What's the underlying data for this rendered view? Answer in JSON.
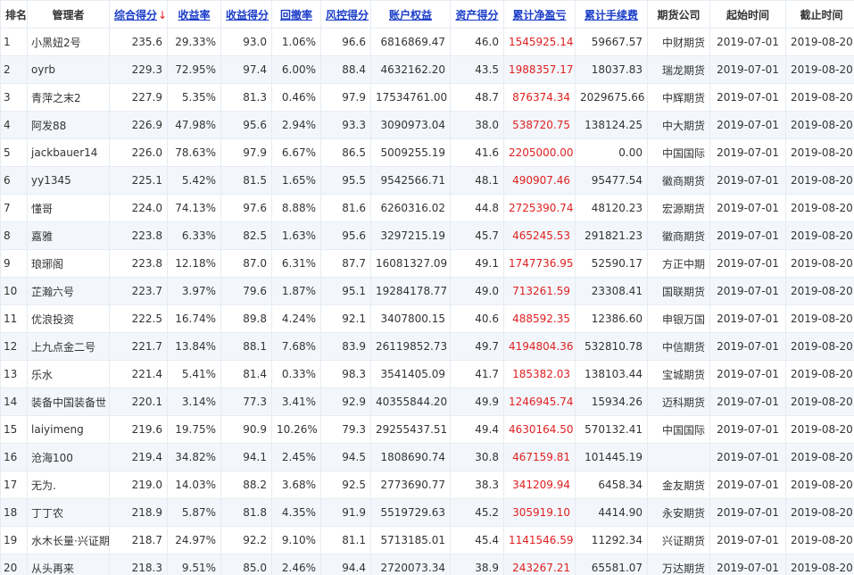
{
  "headers": {
    "rank": "排名",
    "manager": "管理者",
    "total_score": "综合得分",
    "total_score_arrow": "↓",
    "return_rate": "收益率",
    "return_score": "收益得分",
    "drawdown": "回撤率",
    "risk_score": "风控得分",
    "equity": "账户权益",
    "asset_score": "资产得分",
    "net_profit": "累计净盈亏",
    "fees": "累计手续费",
    "broker": "期货公司",
    "start": "起始时间",
    "end": "截止时间"
  },
  "rows": [
    [
      "1",
      "小黑妞2号",
      "235.6",
      "29.33%",
      "93.0",
      "1.06%",
      "96.6",
      "6816869.47",
      "46.0",
      "1545925.14",
      "59667.57",
      "中财期货",
      "2019-07-01",
      "2019-08-20"
    ],
    [
      "2",
      "oyrb",
      "229.3",
      "72.95%",
      "97.4",
      "6.00%",
      "88.4",
      "4632162.20",
      "43.5",
      "1988357.17",
      "18037.83",
      "瑞龙期货",
      "2019-07-01",
      "2019-08-20"
    ],
    [
      "3",
      "青萍之末2",
      "227.9",
      "5.35%",
      "81.3",
      "0.46%",
      "97.9",
      "17534761.00",
      "48.7",
      "876374.34",
      "2029675.66",
      "中辉期货",
      "2019-07-01",
      "2019-08-20"
    ],
    [
      "4",
      "阿发88",
      "226.9",
      "47.98%",
      "95.6",
      "2.94%",
      "93.3",
      "3090973.04",
      "38.0",
      "538720.75",
      "138124.25",
      "中大期货",
      "2019-07-01",
      "2019-08-20"
    ],
    [
      "5",
      "jackbauer14",
      "226.0",
      "78.63%",
      "97.9",
      "6.67%",
      "86.5",
      "5009255.19",
      "41.6",
      "2205000.00",
      "0.00",
      "中国国际",
      "2019-07-01",
      "2019-08-20"
    ],
    [
      "6",
      "yy1345",
      "225.1",
      "5.42%",
      "81.5",
      "1.65%",
      "95.5",
      "9542566.71",
      "48.1",
      "490907.46",
      "95477.54",
      "徽商期货",
      "2019-07-01",
      "2019-08-20"
    ],
    [
      "7",
      "懂哥",
      "224.0",
      "74.13%",
      "97.6",
      "8.88%",
      "81.6",
      "6260316.02",
      "44.8",
      "2725390.74",
      "48120.23",
      "宏源期货",
      "2019-07-01",
      "2019-08-20"
    ],
    [
      "8",
      "嘉雅",
      "223.8",
      "6.33%",
      "82.5",
      "1.63%",
      "95.6",
      "3297215.19",
      "45.7",
      "465245.53",
      "291821.23",
      "徽商期货",
      "2019-07-01",
      "2019-08-20"
    ],
    [
      "9",
      "琅琊阁",
      "223.8",
      "12.18%",
      "87.0",
      "6.31%",
      "87.7",
      "16081327.09",
      "49.1",
      "1747736.95",
      "52590.17",
      "方正中期",
      "2019-07-01",
      "2019-08-20"
    ],
    [
      "10",
      "芷瀚六号",
      "223.7",
      "3.97%",
      "79.6",
      "1.87%",
      "95.1",
      "19284178.77",
      "49.0",
      "713261.59",
      "23308.41",
      "国联期货",
      "2019-07-01",
      "2019-08-20"
    ],
    [
      "11",
      "优浪投资",
      "222.5",
      "16.74%",
      "89.8",
      "4.24%",
      "92.1",
      "3407800.15",
      "40.6",
      "488592.35",
      "12386.60",
      "申银万国",
      "2019-07-01",
      "2019-08-20"
    ],
    [
      "12",
      "上九点金二号",
      "221.7",
      "13.84%",
      "88.1",
      "7.68%",
      "83.9",
      "26119852.73",
      "49.7",
      "4194804.36",
      "532810.78",
      "中信期货",
      "2019-07-01",
      "2019-08-20"
    ],
    [
      "13",
      "乐水",
      "221.4",
      "5.41%",
      "81.4",
      "0.33%",
      "98.3",
      "3541405.09",
      "41.7",
      "185382.03",
      "138103.44",
      "宝城期货",
      "2019-07-01",
      "2019-08-20"
    ],
    [
      "14",
      "装备中国装备世",
      "220.1",
      "3.14%",
      "77.3",
      "3.41%",
      "92.9",
      "40355844.20",
      "49.9",
      "1246945.74",
      "15934.26",
      "迈科期货",
      "2019-07-01",
      "2019-08-20"
    ],
    [
      "15",
      "laiyimeng",
      "219.6",
      "19.75%",
      "90.9",
      "10.26%",
      "79.3",
      "29255437.51",
      "49.4",
      "4630164.50",
      "570132.41",
      "中国国际",
      "2019-07-01",
      "2019-08-20"
    ],
    [
      "16",
      "沧海100",
      "219.4",
      "34.82%",
      "94.1",
      "2.45%",
      "94.5",
      "1808690.74",
      "30.8",
      "467159.81",
      "101445.19",
      "",
      "2019-07-01",
      "2019-08-20"
    ],
    [
      "17",
      "无为.",
      "219.0",
      "14.03%",
      "88.2",
      "3.68%",
      "92.5",
      "2773690.77",
      "38.3",
      "341209.94",
      "6458.34",
      "金友期货",
      "2019-07-01",
      "2019-08-20"
    ],
    [
      "18",
      "丁丁农",
      "218.9",
      "5.87%",
      "81.8",
      "4.35%",
      "91.9",
      "5519729.63",
      "45.2",
      "305919.10",
      "4414.90",
      "永安期货",
      "2019-07-01",
      "2019-08-20"
    ],
    [
      "19",
      "水木长量·兴证期",
      "218.7",
      "24.97%",
      "92.2",
      "9.10%",
      "81.1",
      "5713185.01",
      "45.4",
      "1141546.59",
      "11292.34",
      "兴证期货",
      "2019-07-01",
      "2019-08-20"
    ],
    [
      "20",
      "从头再来",
      "218.3",
      "9.51%",
      "85.0",
      "2.46%",
      "94.4",
      "2720073.34",
      "38.9",
      "243267.21",
      "65581.07",
      "万达期货",
      "2019-07-01",
      "2019-08-20"
    ]
  ]
}
